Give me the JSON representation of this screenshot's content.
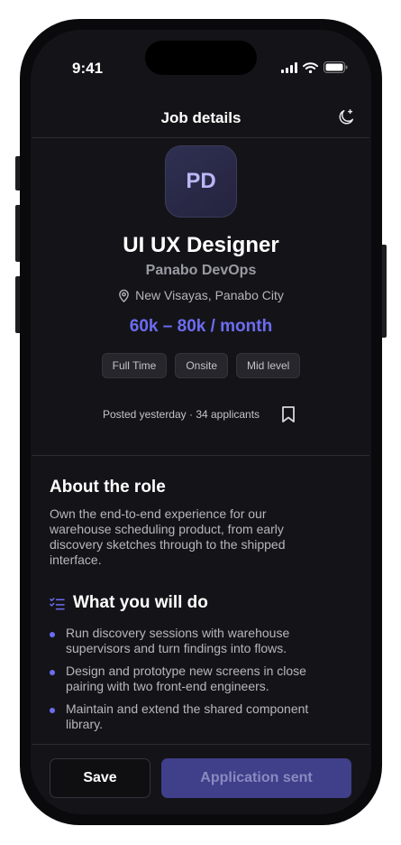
{
  "status_bar": {
    "time": "9:41",
    "icons": [
      "signal-icon",
      "wifi-icon",
      "battery-icon"
    ]
  },
  "header": {
    "title": "Job details",
    "theme_icon": "moon-icon"
  },
  "job": {
    "logo_initials": "PD",
    "title": "UI UX Designer",
    "company": "Panabo DevOps",
    "location": "New Visayas, Panabo City",
    "salary": "60k – 80k / month",
    "tags": [
      "Full Time",
      "Onsite",
      "Mid level"
    ],
    "meta": "Posted yesterday · 34 applicants"
  },
  "about": {
    "title": "About the role",
    "text": "Own the end-to-end experience for our warehouse scheduling product, from early discovery sketches through to the shipped interface."
  },
  "duties": {
    "title": "What you will do",
    "items": [
      "Run discovery sessions with warehouse supervisors and turn findings into flows.",
      "Design and prototype new screens in close pairing with two front-end engineers.",
      "Maintain and extend the shared component library."
    ]
  },
  "footer": {
    "save_label": "Save",
    "sent_label": "Application sent"
  },
  "colors": {
    "accent": "#6c6cf2",
    "background": "#141418",
    "button_disabled": "#3f3f8a"
  }
}
